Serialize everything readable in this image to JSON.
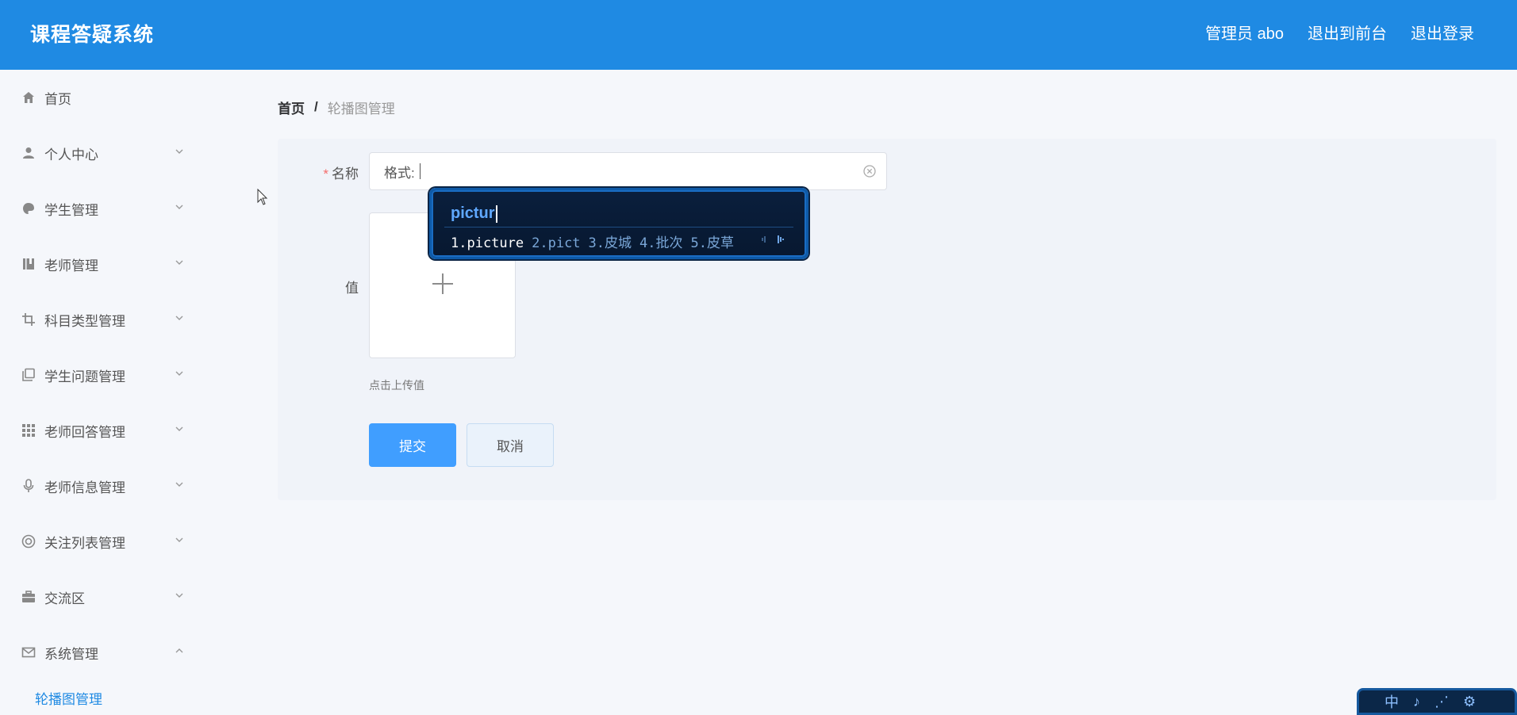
{
  "header": {
    "title": "课程答疑系统",
    "admin_label": "管理员 abo",
    "front_label": "退出到前台",
    "logout_label": "退出登录"
  },
  "sidebar": {
    "items": [
      {
        "label": "首页",
        "icon": "home-icon"
      },
      {
        "label": "个人中心",
        "icon": "user-icon"
      },
      {
        "label": "学生管理",
        "icon": "palette-icon"
      },
      {
        "label": "老师管理",
        "icon": "notebook-icon"
      },
      {
        "label": "科目类型管理",
        "icon": "crop-icon"
      },
      {
        "label": "学生问题管理",
        "icon": "copy-icon"
      },
      {
        "label": "老师回答管理",
        "icon": "grid-icon"
      },
      {
        "label": "老师信息管理",
        "icon": "microphone-icon"
      },
      {
        "label": "关注列表管理",
        "icon": "lifebuoy-icon"
      },
      {
        "label": "交流区",
        "icon": "briefcase-icon"
      },
      {
        "label": "系统管理",
        "icon": "mail-icon"
      }
    ],
    "submenu": {
      "label": "轮播图管理"
    }
  },
  "breadcrumb": {
    "home": "首页",
    "sep": "/",
    "current": "轮播图管理"
  },
  "form": {
    "required_mark": "*",
    "name_label": "名称",
    "name_value": "格式:",
    "value_label": "值",
    "upload_hint": "点击上传值",
    "submit_label": "提交",
    "cancel_label": "取消"
  },
  "ime": {
    "composition": "pictur",
    "candidates": [
      "1.picture",
      "2.pict",
      "3.皮城",
      "4.批次",
      "5.皮草"
    ],
    "toolbar": [
      "中",
      "♪",
      "⋰",
      "⚙"
    ]
  },
  "colors": {
    "header_bg": "#1f8ae3",
    "primary": "#409eff",
    "required": "#f56c6c"
  }
}
